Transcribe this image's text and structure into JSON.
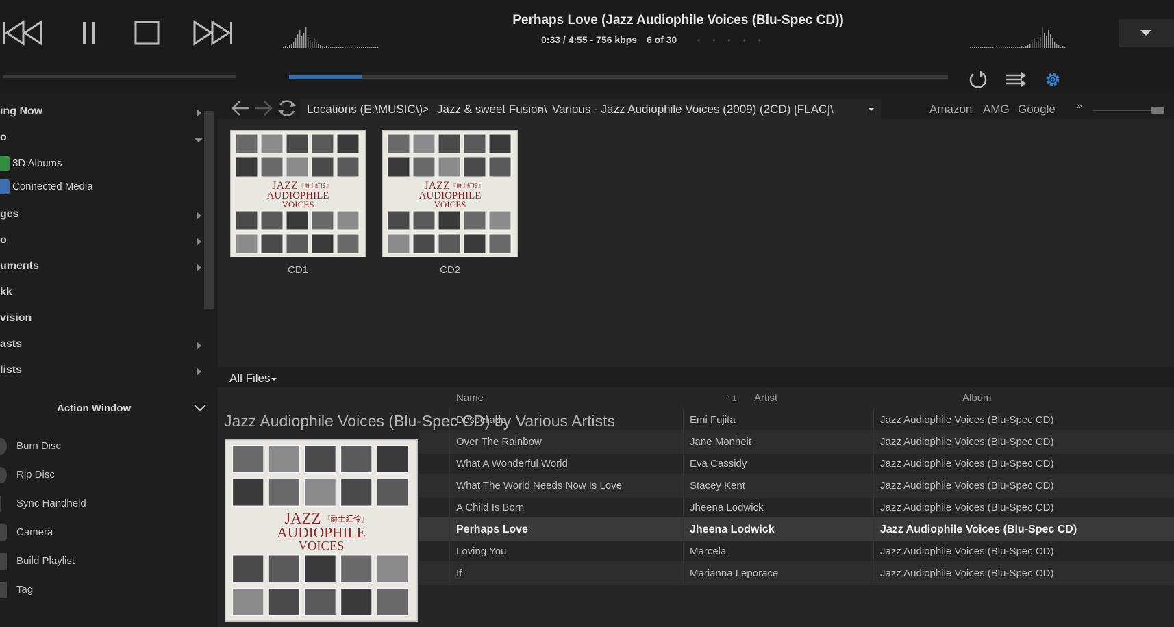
{
  "player": {
    "track_title": "Perhaps Love (Jazz Audiophile Voices (Blu-Spec CD))",
    "time": "0:33 / 4:55 - 756 kbps",
    "position": "6 of 30",
    "seek_fraction": 0.11
  },
  "sidebar": {
    "items": [
      {
        "label": "ing Now",
        "arrow": "right"
      },
      {
        "label": "o",
        "arrow": "down"
      },
      {
        "label": "ges",
        "arrow": "right"
      },
      {
        "label": "o",
        "arrow": "right"
      },
      {
        "label": "uments",
        "arrow": "right"
      },
      {
        "label": "kk",
        "arrow": "none"
      },
      {
        "label": "vision",
        "arrow": "none"
      },
      {
        "label": "asts",
        "arrow": "right"
      },
      {
        "label": "lists",
        "arrow": "right"
      }
    ],
    "subitems": [
      {
        "label": "3D Albums",
        "color": "#2f8f3f"
      },
      {
        "label": "Connected Media",
        "color": "#3d6fb5"
      }
    ],
    "action_window": {
      "title": "Action Window",
      "items": [
        "Burn Disc",
        "Rip Disc",
        "Sync Handheld",
        "Camera",
        "Build Playlist",
        "Tag"
      ]
    }
  },
  "nav": {
    "breadcrumb": [
      "Locations (E:\\MUSIC\\)",
      "Jazz & sweet Fusion\\",
      "Various - Jazz Audiophile Voices (2009) (2CD) [FLAC]\\"
    ],
    "separator": ">",
    "links": [
      "Amazon",
      "AMG",
      "Google"
    ],
    "more": "»"
  },
  "thumbnails": [
    {
      "caption": "CD1"
    },
    {
      "caption": "CD2"
    }
  ],
  "cover": {
    "title": "JAZZ",
    "subtitle_cn": "『爵士紅伶』",
    "line2": "AUDIOPHILE",
    "line3": "VOICES"
  },
  "files": {
    "tab_label": "All Files",
    "columns": {
      "name": "Name",
      "artist": "Artist",
      "album": "Album"
    },
    "sort_indicator": "^ 1",
    "group_title": "Jazz Audiophile Voices (Blu-Spec CD) by Various Artists",
    "rows": [
      {
        "name": "Desperado",
        "artist": "Emi Fujita",
        "album": "Jazz Audiophile Voices (Blu-Spec CD)"
      },
      {
        "name": "Over The Rainbow",
        "artist": "Jane Monheit",
        "album": "Jazz Audiophile Voices (Blu-Spec CD)"
      },
      {
        "name": "What A Wonderful World",
        "artist": "Eva Cassidy",
        "album": "Jazz Audiophile Voices (Blu-Spec CD)"
      },
      {
        "name": "What The World Needs Now Is Love",
        "artist": "Stacey Kent",
        "album": "Jazz Audiophile Voices (Blu-Spec CD)"
      },
      {
        "name": "A Child Is Born",
        "artist": "Jheena Lodwick",
        "album": "Jazz Audiophile Voices (Blu-Spec CD)"
      },
      {
        "name": "Perhaps Love",
        "artist": "Jheena Lodwick",
        "album": "Jazz Audiophile Voices (Blu-Spec CD)",
        "playing": true
      },
      {
        "name": "Loving You",
        "artist": "Marcela",
        "album": "Jazz Audiophile Voices (Blu-Spec CD)"
      },
      {
        "name": "If",
        "artist": "Marianna Leporace",
        "album": "Jazz Audiophile Voices (Blu-Spec CD)"
      }
    ]
  },
  "colors": {
    "accent": "#2d6fb6",
    "settings_icon": "#2f86d6"
  }
}
